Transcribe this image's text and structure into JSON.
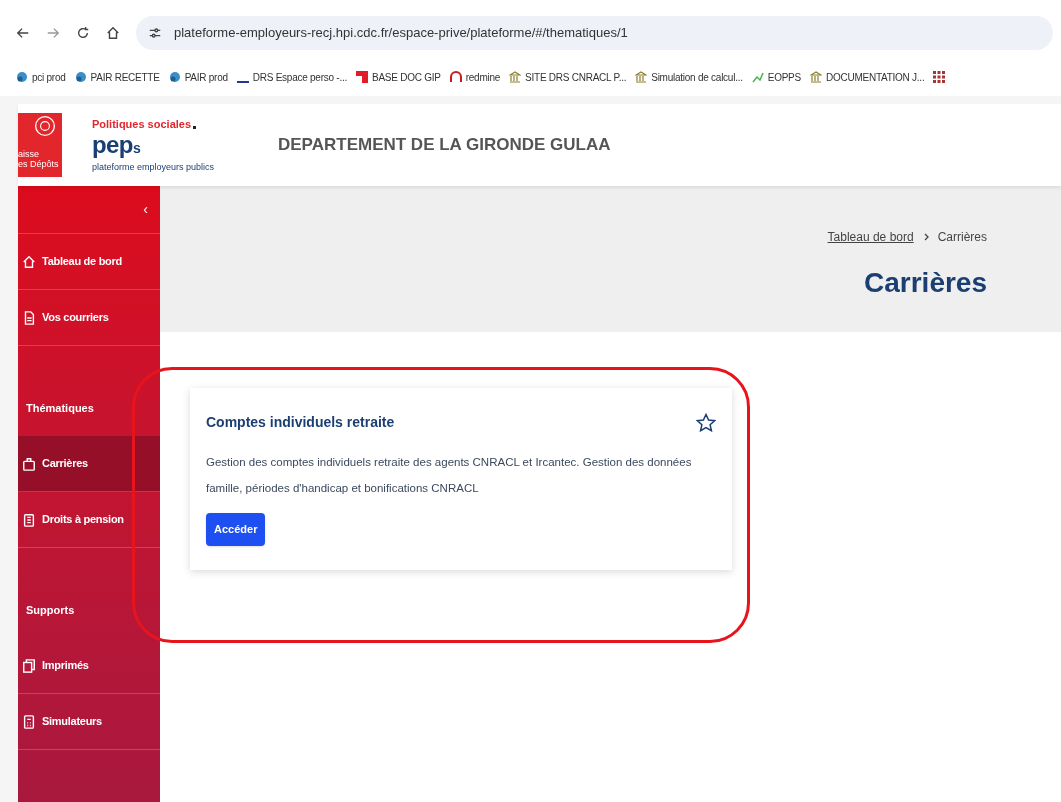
{
  "browser": {
    "url": "plateforme-employeurs-recj.hpi.cdc.fr/espace-prive/plateforme/#/thematiques/1",
    "bookmarks": [
      "pci prod",
      "PAIR RECETTE",
      "PAIR prod",
      "DRS Espace perso -...",
      "BASE DOC GIP",
      "redmine",
      "SITE DRS CNRACL P...",
      "Simulation de calcul...",
      "EOPPS",
      "DOCUMENTATION J..."
    ]
  },
  "header": {
    "logo_lines": [
      "aisse",
      "es Dépôts"
    ],
    "tagline": "Politiques sociales",
    "brand": "pep",
    "brand_suffix": "s",
    "brand_sub": "plateforme employeurs publics",
    "organisation": "DEPARTEMENT DE LA GIRONDE GULAA"
  },
  "sidebar": {
    "collapse": "‹",
    "items": [
      {
        "kind": "link",
        "label": "Tableau de bord",
        "selected": false
      },
      {
        "kind": "link",
        "label": "Vos courriers",
        "selected": false
      },
      {
        "kind": "section",
        "label": "Thématiques"
      },
      {
        "kind": "link",
        "label": "Carrières",
        "selected": true
      },
      {
        "kind": "link",
        "label": "Droits à pension",
        "selected": false
      },
      {
        "kind": "section",
        "label": "Supports"
      },
      {
        "kind": "link",
        "label": "Imprimés",
        "selected": false
      },
      {
        "kind": "link",
        "label": "Simulateurs",
        "selected": false
      }
    ]
  },
  "breadcrumb": [
    {
      "label": "Tableau de bord",
      "link": true
    },
    {
      "label": "Carrières",
      "link": false
    }
  ],
  "page_title": "Carrières",
  "cards": [
    {
      "title": "Comptes individuels retraite",
      "favorite": false,
      "description": "Gestion des comptes individuels retraite des agents CNRACL et Ircantec. Gestion des données famille, périodes d'handicap et bonifications CNRACL",
      "button": "Accéder"
    }
  ]
}
